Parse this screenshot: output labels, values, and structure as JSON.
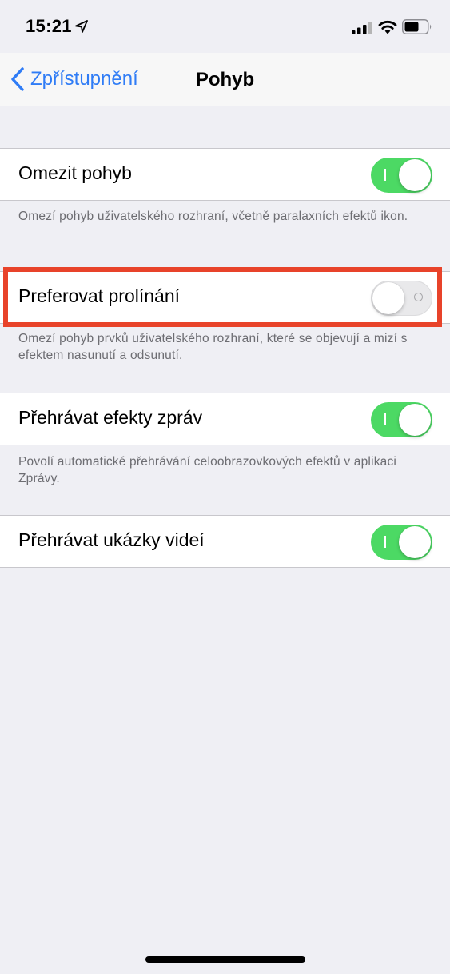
{
  "status_bar": {
    "time": "15:21",
    "icons": [
      "location-arrow-icon",
      "cellular-signal-icon",
      "wifi-icon",
      "battery-icon"
    ]
  },
  "nav": {
    "back_label": "Zpřístupnění",
    "title": "Pohyb"
  },
  "settings": [
    {
      "label": "Omezit pohyb",
      "enabled": true,
      "footer": "Omezí pohyb uživatelského rozhraní, včetně paralaxních efektů ikon."
    },
    {
      "label": "Preferovat prolínání",
      "enabled": false,
      "footer": "Omezí pohyb prvků uživatelského rozhraní, které se objevují a mizí s efektem nasunutí a odsunutí."
    },
    {
      "label": "Přehrávat efekty zpráv",
      "enabled": true,
      "footer": "Povolí automatické přehrávání celoobrazovkových efektů v aplikaci Zprávy."
    },
    {
      "label": "Přehrávat ukázky videí",
      "enabled": true,
      "footer": ""
    }
  ],
  "colors": {
    "accent": "#2f7cf6",
    "toggle_on": "#4cd964",
    "highlight": "#e8432a",
    "background": "#efeff4"
  }
}
